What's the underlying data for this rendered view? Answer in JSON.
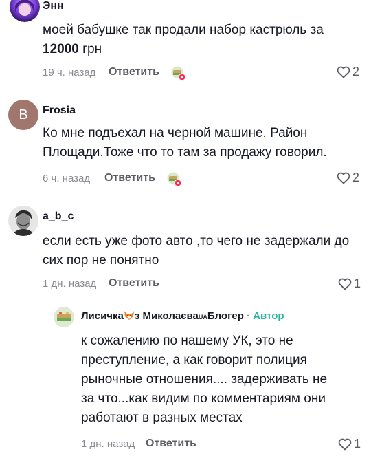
{
  "comments": [
    {
      "username": "Энн",
      "text_line1": "моей бабушке так продали набор кастрюль за",
      "text_bold": "12000",
      "text_rest": " грн",
      "time": "19 ч. назад",
      "reply": "Ответить",
      "likes": "2"
    },
    {
      "username": "Frosia",
      "avatar_letter": "B",
      "text": "Ко мне подъехал на черной машине. Район Площади.Тоже что то там за продажу говорил.",
      "time": "6 ч. назад",
      "reply": "Ответить",
      "likes": "2"
    },
    {
      "username": "a_b_c",
      "text": "если есть уже фото авто ,то чего не задержали до сих пор не понятно",
      "time": "1 дн. назад",
      "reply": "Ответить",
      "likes": "1"
    }
  ],
  "reply": {
    "username_part1": "Лисичка",
    "username_part2": "з Миколаєва",
    "username_tag": "UA",
    "username_part3": "Блогер",
    "separator": "·",
    "author_label": "Автор",
    "text": "к сожалению по нашему УК, это не преступление, а как говорит полиция рыночные отношения.... задерживать не за что...как видим по комментариям они работают в разных местах",
    "time": "1 дн. назад",
    "reply": "Ответить",
    "likes": "1"
  },
  "colors": {
    "accent_author": "#25b69f",
    "frosia_avatar": "#a1766c",
    "creator_heart": "#fe2c55"
  }
}
